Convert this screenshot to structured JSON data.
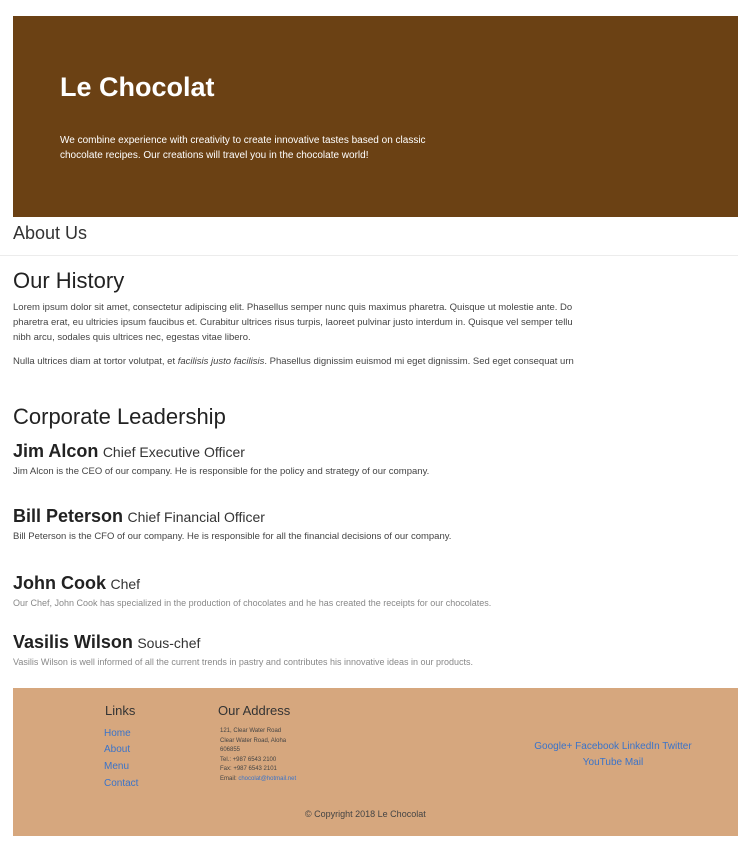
{
  "hero": {
    "title": "Le Chocolat",
    "subtitle_line1": "We combine experience with creativity to create innovative tastes based on classic",
    "subtitle_line2": "chocolate recipes. Our creations will travel you in the chocolate world!"
  },
  "about_bar": {
    "label": "About Us"
  },
  "history": {
    "heading": "Our History",
    "p1_line1": "Lorem ipsum dolor sit amet, consectetur adipiscing elit. Phasellus semper nunc quis maximus pharetra. Quisque ut molestie ante. Do",
    "p1_line2": "pharetra erat, eu ultricies ipsum faucibus et. Curabitur ultrices risus turpis, laoreet pulvinar justo interdum in. Quisque vel semper tellu",
    "p1_line3": "nibh arcu, sodales quis ultrices nec, egestas vitae libero.",
    "p2_start": "Nulla ultrices diam at tortor volutpat, et ",
    "p2_em": "facilisis justo facilisis",
    "p2_end": ". Phasellus dignissim euismod mi eget dignissim. Sed eget consequat urn"
  },
  "leadership": {
    "heading": "Corporate Leadership",
    "people": [
      {
        "name": "Jim Alcon",
        "role": "Chief Executive Officer",
        "desc": "Jim Alcon is the CEO of our company. He is responsible for the policy and strategy of our company."
      },
      {
        "name": "Bill Peterson",
        "role": "Chief Financial Officer",
        "desc": "Bill Peterson is the CFO of our company. He is responsible for all the financial decisions of our company."
      },
      {
        "name": "John Cook",
        "role": "Chef",
        "desc": "Our Chef, John Cook has specialized in the production of chocolates and he has created the receipts for our chocolates."
      },
      {
        "name": "Vasilis Wilson",
        "role": "Sous-chef",
        "desc": "Vasilis Wilson is well informed of all the current trends in pastry and contributes his innovative ideas in our products."
      }
    ]
  },
  "footer": {
    "links_heading": "Links",
    "links": [
      "Home",
      "About",
      "Menu",
      "Contact"
    ],
    "address_heading": "Our Address",
    "address_lines": [
      "121, Clear Water Road",
      "Clear Water Road, Aloha",
      "606855",
      "Tel.: +987 6543 2100",
      "Fax: +987 6543 2101"
    ],
    "email_label": "Email: ",
    "email": "chocolat@hotmail.net",
    "social_line1": "Google+ Facebook LinkedIn Twitter",
    "social_line2": "YouTube Mail",
    "copyright": "© Copyright 2018 Le Chocolat"
  }
}
